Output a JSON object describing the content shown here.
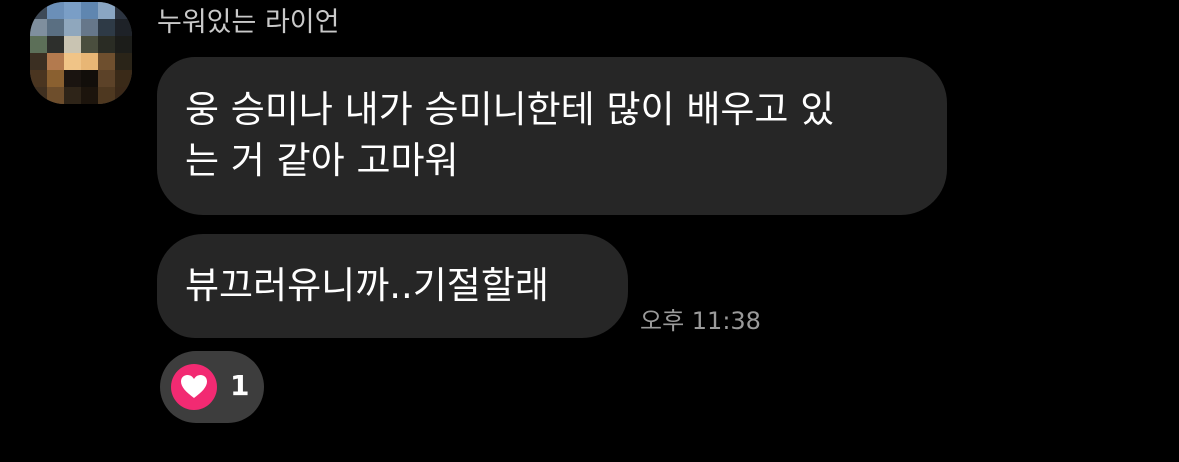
{
  "conversation": {
    "sender": {
      "name": "누워있는 라이언",
      "avatar_colors": [
        "#3e4a58",
        "#6b8fb8",
        "#7a9ec6",
        "#5f86b0",
        "#8aa6c3",
        "#2c3440",
        "#7f8f9e",
        "#5a6f82",
        "#8fa7bd",
        "#66778a",
        "#2e3a46",
        "#1e2228",
        "#5c6f58",
        "#2d2f2c",
        "#c9c4b2",
        "#4a4e3e",
        "#2a2c24",
        "#1c1d1a",
        "#3b2f22",
        "#b37a4e",
        "#f0c487",
        "#e8b675",
        "#6e4f2e",
        "#2a2418",
        "#4a3520",
        "#8a6030",
        "#1a1410",
        "#120e0a",
        "#5c4228",
        "#3a2a18",
        "#403020",
        "#6e4e2c",
        "#2e2418",
        "#1c140c",
        "#4e3820",
        "#3a2818"
      ]
    },
    "messages": [
      {
        "lines": [
          "웅 승미나 내가 승미니한테 많이 배우고 있",
          "는 거 같아 고마워"
        ]
      },
      {
        "text": "뷰끄러유니까..기절할래",
        "time": "오후 11:38"
      }
    ],
    "reaction": {
      "icon": "heart-icon",
      "count": "1",
      "color": "#f22a72"
    }
  }
}
